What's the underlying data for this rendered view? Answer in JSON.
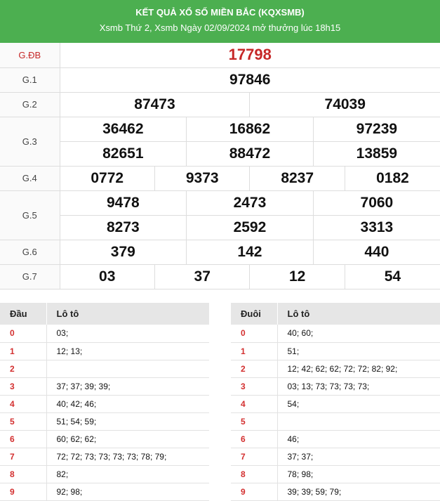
{
  "header": {
    "title": "KẾT QUẢ XỔ SỐ MIỀN BẮC (KQXSMB)",
    "subtitle": "Xsmb Thứ 2, Xsmb Ngày 02/09/2024 mở thưởng lúc 18h15"
  },
  "prizes": [
    {
      "label": "G.ĐB",
      "rows": [
        [
          "17798"
        ]
      ]
    },
    {
      "label": "G.1",
      "rows": [
        [
          "97846"
        ]
      ]
    },
    {
      "label": "G.2",
      "rows": [
        [
          "87473",
          "74039"
        ]
      ]
    },
    {
      "label": "G.3",
      "rows": [
        [
          "36462",
          "16862",
          "97239"
        ],
        [
          "82651",
          "88472",
          "13859"
        ]
      ]
    },
    {
      "label": "G.4",
      "rows": [
        [
          "0772",
          "9373",
          "8237",
          "0182"
        ]
      ]
    },
    {
      "label": "G.5",
      "rows": [
        [
          "9478",
          "2473",
          "7060"
        ],
        [
          "8273",
          "2592",
          "3313"
        ]
      ]
    },
    {
      "label": "G.6",
      "rows": [
        [
          "379",
          "142",
          "440"
        ]
      ]
    },
    {
      "label": "G.7",
      "rows": [
        [
          "03",
          "37",
          "12",
          "54"
        ]
      ]
    }
  ],
  "dau": {
    "col1": "Đầu",
    "col2": "Lô tô",
    "rows": [
      {
        "k": "0",
        "v": "03;"
      },
      {
        "k": "1",
        "v": "12; 13;"
      },
      {
        "k": "2",
        "v": ""
      },
      {
        "k": "3",
        "v": "37; 37; 39; 39;"
      },
      {
        "k": "4",
        "v": "40; 42; 46;"
      },
      {
        "k": "5",
        "v": "51; 54; 59;"
      },
      {
        "k": "6",
        "v": "60; 62; 62;"
      },
      {
        "k": "7",
        "v": "72; 72; 73; 73; 73; 73; 78; 79;"
      },
      {
        "k": "8",
        "v": "82;"
      },
      {
        "k": "9",
        "v": "92; 98;"
      }
    ]
  },
  "duoi": {
    "col1": "Đuôi",
    "col2": "Lô tô",
    "rows": [
      {
        "k": "0",
        "v": "40; 60;"
      },
      {
        "k": "1",
        "v": "51;"
      },
      {
        "k": "2",
        "v": "12; 42; 62; 62; 72; 72; 82; 92;"
      },
      {
        "k": "3",
        "v": "03; 13; 73; 73; 73; 73;"
      },
      {
        "k": "4",
        "v": "54;"
      },
      {
        "k": "5",
        "v": ""
      },
      {
        "k": "6",
        "v": "46;"
      },
      {
        "k": "7",
        "v": "37; 37;"
      },
      {
        "k": "8",
        "v": "78; 98;"
      },
      {
        "k": "9",
        "v": "39; 39; 59; 79;"
      }
    ]
  }
}
